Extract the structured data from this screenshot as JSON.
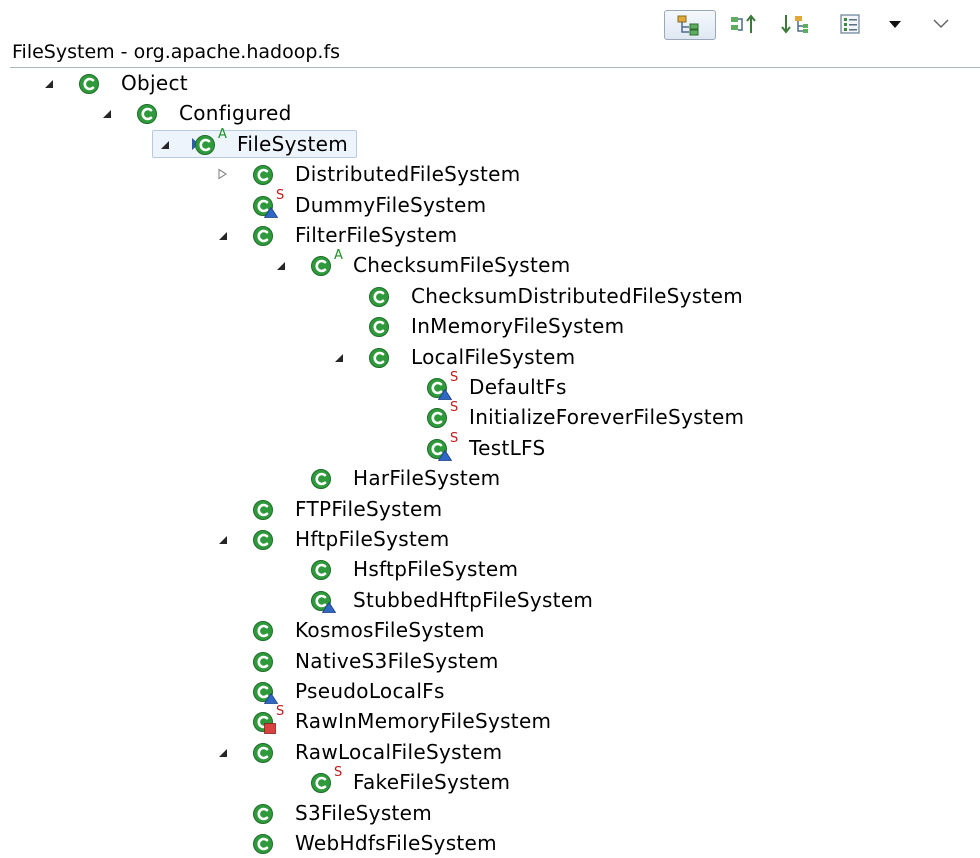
{
  "view_title": "FileSystem - org.apache.hadoop.fs",
  "toolbar": {
    "hierarchy_icon": "type-hierarchy-icon",
    "supertype_icon": "supertype-hierarchy-icon",
    "subtype_icon": "subtype-hierarchy-icon",
    "members_icon": "show-members-icon",
    "menu_icon": "view-menu-icon",
    "more_icon": "chevron-more-icon"
  },
  "colors": {
    "class_icon": "#2f9a3b",
    "static_badge": "#c41919",
    "abstract_badge": "#1c8f24",
    "protected_overlay": "#2f67c4",
    "private_overlay": "#d9433f"
  },
  "tree": [
    {
      "label": "Object",
      "depth": 0,
      "twisty": "expanded",
      "badge": "",
      "overlay": ""
    },
    {
      "label": "Configured",
      "depth": 1,
      "twisty": "expanded",
      "badge": "",
      "overlay": ""
    },
    {
      "label": "FileSystem",
      "depth": 2,
      "twisty": "expanded",
      "badge": "A",
      "overlay": "",
      "selected": true
    },
    {
      "label": "DistributedFileSystem",
      "depth": 3,
      "twisty": "collapsed",
      "badge": "",
      "overlay": ""
    },
    {
      "label": "DummyFileSystem",
      "depth": 3,
      "twisty": "none",
      "badge": "S",
      "overlay": "protected"
    },
    {
      "label": "FilterFileSystem",
      "depth": 3,
      "twisty": "expanded",
      "badge": "",
      "overlay": ""
    },
    {
      "label": "ChecksumFileSystem",
      "depth": 4,
      "twisty": "expanded",
      "badge": "A",
      "overlay": ""
    },
    {
      "label": "ChecksumDistributedFileSystem",
      "depth": 5,
      "twisty": "none",
      "badge": "",
      "overlay": ""
    },
    {
      "label": "InMemoryFileSystem",
      "depth": 5,
      "twisty": "none",
      "badge": "",
      "overlay": ""
    },
    {
      "label": "LocalFileSystem",
      "depth": 5,
      "twisty": "expanded",
      "badge": "",
      "overlay": ""
    },
    {
      "label": "DefaultFs",
      "depth": 6,
      "twisty": "none",
      "badge": "S",
      "overlay": "protected"
    },
    {
      "label": "InitializeForeverFileSystem",
      "depth": 6,
      "twisty": "none",
      "badge": "S",
      "overlay": ""
    },
    {
      "label": "TestLFS",
      "depth": 6,
      "twisty": "none",
      "badge": "S",
      "overlay": "protected"
    },
    {
      "label": "HarFileSystem",
      "depth": 4,
      "twisty": "none",
      "badge": "",
      "overlay": ""
    },
    {
      "label": "FTPFileSystem",
      "depth": 3,
      "twisty": "none",
      "badge": "",
      "overlay": ""
    },
    {
      "label": "HftpFileSystem",
      "depth": 3,
      "twisty": "expanded",
      "badge": "",
      "overlay": ""
    },
    {
      "label": "HsftpFileSystem",
      "depth": 4,
      "twisty": "none",
      "badge": "",
      "overlay": ""
    },
    {
      "label": "StubbedHftpFileSystem",
      "depth": 4,
      "twisty": "none",
      "badge": "",
      "overlay": "protected"
    },
    {
      "label": "KosmosFileSystem",
      "depth": 3,
      "twisty": "none",
      "badge": "",
      "overlay": ""
    },
    {
      "label": "NativeS3FileSystem",
      "depth": 3,
      "twisty": "none",
      "badge": "",
      "overlay": ""
    },
    {
      "label": "PseudoLocalFs",
      "depth": 3,
      "twisty": "none",
      "badge": "",
      "overlay": "protected"
    },
    {
      "label": "RawInMemoryFileSystem",
      "depth": 3,
      "twisty": "none",
      "badge": "S",
      "overlay": "private"
    },
    {
      "label": "RawLocalFileSystem",
      "depth": 3,
      "twisty": "expanded",
      "badge": "",
      "overlay": ""
    },
    {
      "label": "FakeFileSystem",
      "depth": 4,
      "twisty": "none",
      "badge": "S",
      "overlay": ""
    },
    {
      "label": "S3FileSystem",
      "depth": 3,
      "twisty": "none",
      "badge": "",
      "overlay": ""
    },
    {
      "label": "WebHdfsFileSystem",
      "depth": 3,
      "twisty": "none",
      "badge": "",
      "overlay": ""
    }
  ]
}
